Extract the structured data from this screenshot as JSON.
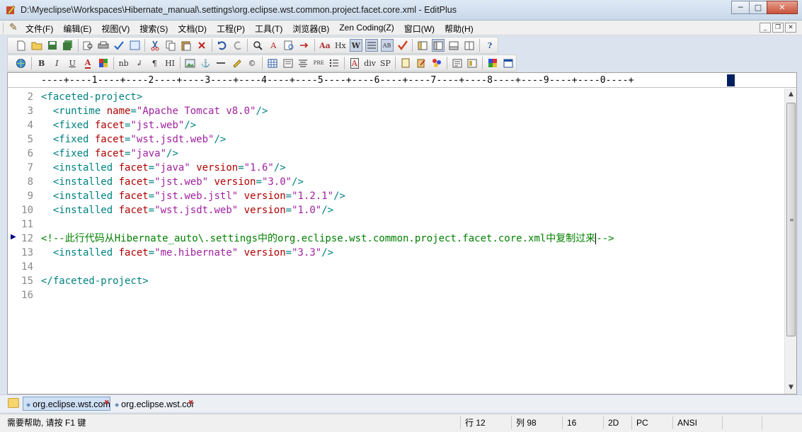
{
  "window": {
    "title": "D:\\Myeclipse\\Workspaces\\Hibernate_manual\\.settings\\org.eclipse.wst.common.project.facet.core.xml - EditPlus",
    "minimize_glyph": "─",
    "maximize_glyph": "□",
    "close_glyph": "✕"
  },
  "menu": {
    "items": [
      "文件(F)",
      "编辑(E)",
      "视图(V)",
      "搜索(S)",
      "文档(D)",
      "工程(P)",
      "工具(T)",
      "浏览器(B)",
      "Zen Coding(Z)",
      "窗口(W)",
      "帮助(H)"
    ]
  },
  "toolbar2": {
    "labels": {
      "bold": "B",
      "italic": "I",
      "underline": "U",
      "font_color": "A",
      "nb": "nb",
      "para": "¶",
      "hi": "HI",
      "pre": "PRE",
      "div": "div",
      "sp": "SP"
    }
  },
  "ruler": {
    "text": "----+----1----+----2----+----3----+----4----+----5----+----6----+----7----+----8----+----9----+----0----+"
  },
  "editor": {
    "line_numbers": [
      "2",
      "3",
      "4",
      "5",
      "6",
      "7",
      "8",
      "9",
      "10",
      "11",
      "12",
      "13",
      "14",
      "15",
      "16"
    ],
    "lines": [
      "<faceted-project>",
      "  <runtime name=\"Apache Tomcat v8.0\"/>",
      "  <fixed facet=\"jst.web\"/>",
      "  <fixed facet=\"wst.jsdt.web\"/>",
      "  <fixed facet=\"java\"/>",
      "  <installed facet=\"java\" version=\"1.6\"/>",
      "  <installed facet=\"jst.web\" version=\"3.0\"/>",
      "  <installed facet=\"jst.web.jstl\" version=\"1.2.1\"/>",
      "  <installed facet=\"wst.jsdt.web\" version=\"1.0\"/>",
      "",
      "<!--此行代码从Hibernate_auto\\.settings中的org.eclipse.wst.common.project.facet.core.xml中复制过来-->",
      "  <installed facet=\"me.hibernate\" version=\"3.3\"/>",
      "",
      "</faceted-project>",
      ""
    ],
    "current_line": "12",
    "colors": {
      "tag": "#008080",
      "attribute": "#b00000",
      "value": "#a020a0",
      "comment": "#008000",
      "line_number": "#8a8a8a"
    }
  },
  "tabs": [
    {
      "label": "org.eclipse.wst.common.project.facet.core.xml",
      "active": true
    },
    {
      "label": "org.eclipse.wst.common.project.facet.core.xml",
      "active": false
    }
  ],
  "status": {
    "help": "需要帮助, 请按 F1 键",
    "row": "行 12",
    "col": "列 98",
    "num": "16",
    "mode_2d": "2D",
    "line_ending": "PC",
    "encoding": "ANSI"
  }
}
